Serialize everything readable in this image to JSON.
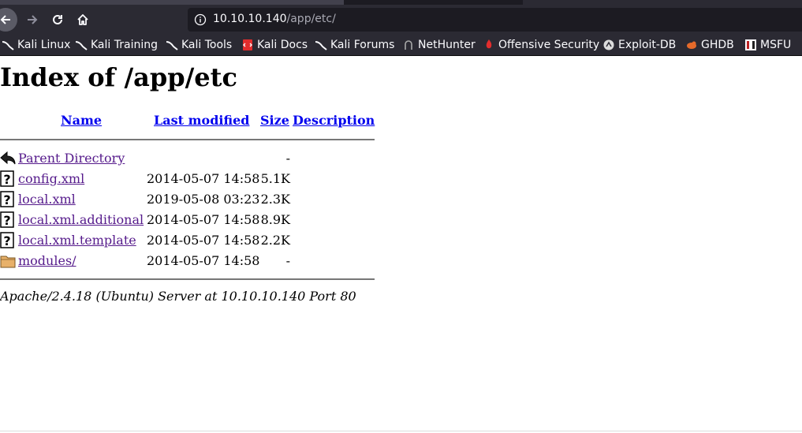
{
  "browser": {
    "url_host": "10.10.10.140",
    "url_path": "/app/etc/",
    "bookmarks": [
      {
        "label": "Kali Linux",
        "icon": "kali-dragon-icon"
      },
      {
        "label": "Kali Training",
        "icon": "kali-dragon-icon"
      },
      {
        "label": "Kali Tools",
        "icon": "kali-dragon-icon"
      },
      {
        "label": "Kali Docs",
        "icon": "kali-docs-icon"
      },
      {
        "label": "Kali Forums",
        "icon": "kali-dragon-icon"
      },
      {
        "label": "NetHunter",
        "icon": "nethunter-icon"
      },
      {
        "label": "Offensive Security",
        "icon": "offsec-icon"
      },
      {
        "label": "Exploit-DB",
        "icon": "exploitdb-icon"
      },
      {
        "label": "GHDB",
        "icon": "ghdb-icon"
      },
      {
        "label": "MSFU",
        "icon": "msfu-icon"
      }
    ]
  },
  "page": {
    "title": "Index of /app/etc",
    "headers": {
      "name": "Name",
      "last_modified": "Last modified",
      "size": "Size",
      "description": "Description"
    },
    "rows": [
      {
        "name": "Parent Directory",
        "date": "",
        "size": "-",
        "icon": "back-arrow-icon"
      },
      {
        "name": "config.xml",
        "date": "2014-05-07 14:58",
        "size": "5.1K",
        "icon": "unknown-file-icon"
      },
      {
        "name": "local.xml",
        "date": "2019-05-08 03:23",
        "size": "2.3K",
        "icon": "unknown-file-icon"
      },
      {
        "name": "local.xml.additional",
        "date": "2014-05-07 14:58",
        "size": "8.9K",
        "icon": "unknown-file-icon"
      },
      {
        "name": "local.xml.template",
        "date": "2014-05-07 14:58",
        "size": "2.2K",
        "icon": "unknown-file-icon"
      },
      {
        "name": "modules/",
        "date": "2014-05-07 14:58",
        "size": "-",
        "icon": "folder-icon"
      }
    ],
    "address": "Apache/2.4.18 (Ubuntu) Server at 10.10.10.140 Port 80"
  }
}
